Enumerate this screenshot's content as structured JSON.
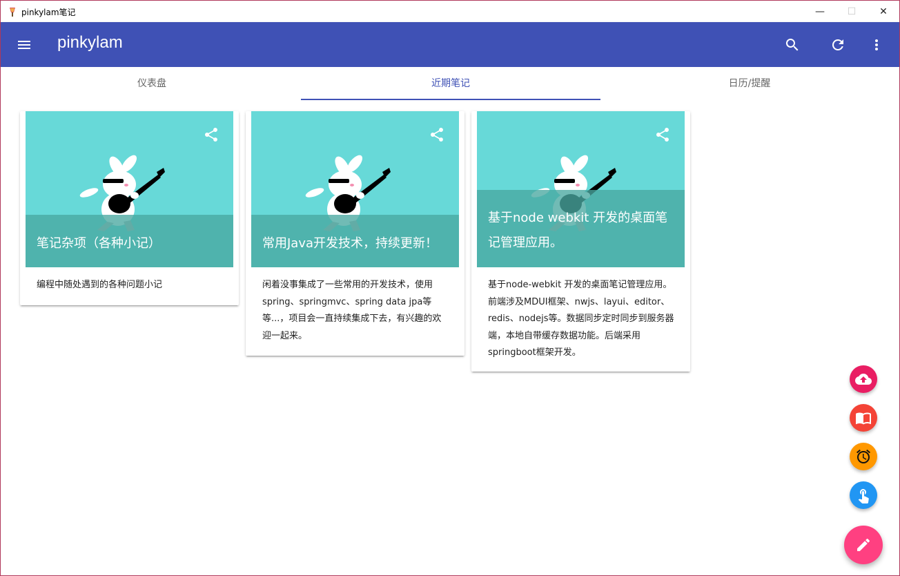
{
  "window": {
    "title": "pinkylam笔记",
    "min_glyph": "—",
    "max_glyph": "☐",
    "close_glyph": "✕"
  },
  "appbar": {
    "brand": "pinkylam",
    "color": "#3f51b5",
    "icons": [
      "menu-icon",
      "search-icon",
      "refresh-icon",
      "more-vert-icon"
    ]
  },
  "tabs": [
    {
      "label": "仪表盘",
      "active": false
    },
    {
      "label": "近期笔记",
      "active": true
    },
    {
      "label": "日历/提醒",
      "active": false
    }
  ],
  "cards": [
    {
      "title": "笔记杂项（各种小记）",
      "description": "编程中随处遇到的各种问题小记"
    },
    {
      "title": "常用Java开发技术，持续更新！",
      "description": "闲着没事集成了一些常用的开发技术，使用spring、springmvc、spring data jpa等等...，项目会一直持续集成下去，有兴趣的欢迎一起来。"
    },
    {
      "title": "基于node webkit 开发的桌面笔记管理应用。",
      "description": "基于node-webkit 开发的桌面笔记管理应用。前端涉及MDUI框架、nwjs、layui、editor、redis、nodejs等。数据同步定时同步到服务器端，本地自带缓存数据功能。后端采用springboot框架开发。"
    }
  ],
  "fabs": [
    {
      "icon": "cloud-upload-icon",
      "color": "#e91e63"
    },
    {
      "icon": "book-icon",
      "color": "#f44336"
    },
    {
      "icon": "alarm-icon",
      "color": "#ff9800"
    },
    {
      "icon": "touch-icon",
      "color": "#2196f3"
    },
    {
      "icon": "edit-icon",
      "color": "#ff4081"
    }
  ]
}
